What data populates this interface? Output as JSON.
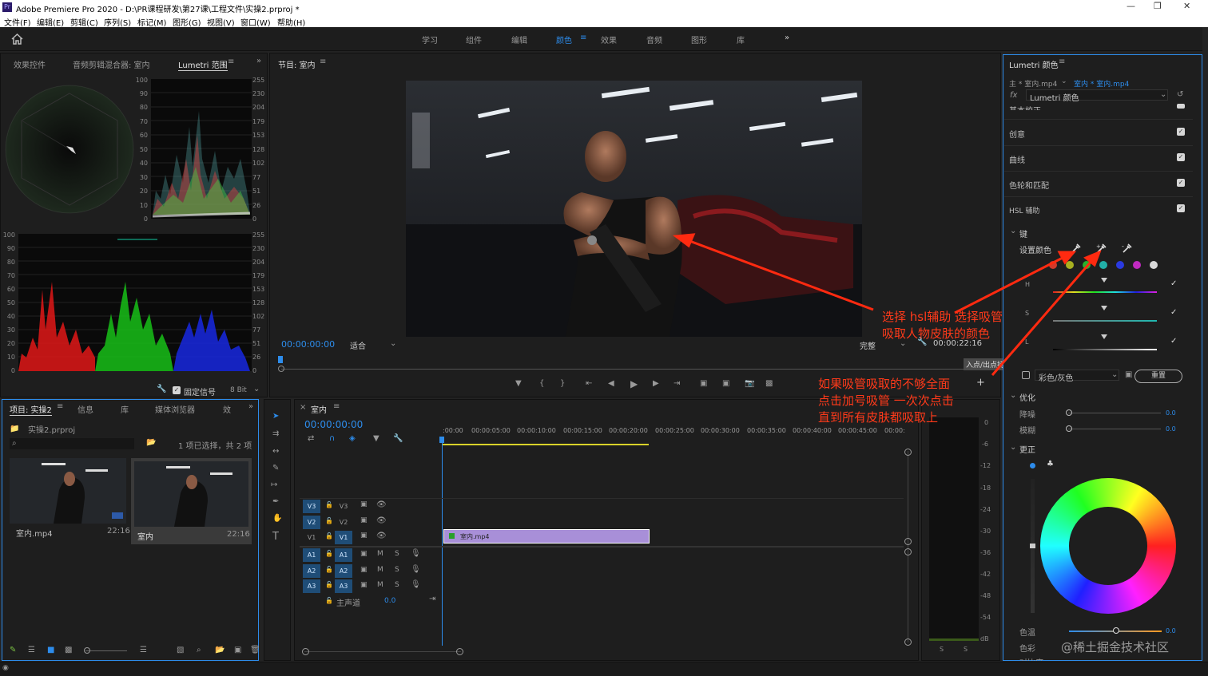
{
  "app": {
    "title": "Adobe Premiere Pro 2020 - D:\\PR课程研发\\第27课\\工程文件\\实操2.prproj *",
    "logo": "Pr"
  },
  "menu": [
    "文件(F)",
    "编辑(E)",
    "剪辑(C)",
    "序列(S)",
    "标记(M)",
    "图形(G)",
    "视图(V)",
    "窗口(W)",
    "帮助(H)"
  ],
  "workspaces": [
    "学习",
    "组件",
    "编辑",
    "颜色",
    "效果",
    "音频",
    "图形",
    "库"
  ],
  "active_workspace": "颜色",
  "left_tabs": {
    "effects": "效果控件",
    "mixer": "音频剪辑混合器: 室内",
    "scopes": "Lumetri 范围"
  },
  "scope_scale_left": [
    "100",
    "90",
    "80",
    "70",
    "60",
    "50",
    "40",
    "30",
    "20",
    "10",
    "0"
  ],
  "scope_scale_right": [
    "255",
    "230",
    "204",
    "179",
    "153",
    "128",
    "102",
    "77",
    "51",
    "26",
    "0"
  ],
  "scope_footer": {
    "clamp": "固定信号",
    "bit": "8 Bit"
  },
  "program": {
    "title": "节目: 室内",
    "timecode": "00:00:00:00",
    "fit": "适合",
    "quality": "完整",
    "duration": "00:00:22:16",
    "tooltip": "入点/出点持续时间"
  },
  "project": {
    "tabs": [
      "项目: 实操2",
      "信息",
      "库",
      "媒体浏览器",
      "效"
    ],
    "file": "实操2.prproj",
    "status": "1 项已选择，共 2 项",
    "items": [
      {
        "name": "室内.mp4",
        "dur": "22:16"
      },
      {
        "name": "室内",
        "dur": "22:16"
      }
    ]
  },
  "sequence": {
    "title": "室内",
    "timecode": "00:00:00:00",
    "ruler": [
      ":00:00",
      "00:00:05:00",
      "00:00:10:00",
      "00:00:15:00",
      "00:00:20:00",
      "00:00:25:00",
      "00:00:30:00",
      "00:00:35:00",
      "00:00:40:00",
      "00:00:45:00",
      "00:00:"
    ],
    "video_tracks": [
      "V3",
      "V2",
      "V1"
    ],
    "audio_tracks": [
      "A1",
      "A2",
      "A3"
    ],
    "master": "主声道",
    "master_val": "0.0",
    "clip": "室内.mp4"
  },
  "meter_scale": [
    "0",
    "-6",
    "-12",
    "-18",
    "-24",
    "-30",
    "-36",
    "-42",
    "-48",
    "-54",
    "dB"
  ],
  "meter_bottom": [
    "S",
    "S"
  ],
  "lumetri": {
    "title": "Lumetri 颜色",
    "source": "主 * 室内.mp4",
    "seq": "室内 * 室内.mp4",
    "fx": "Lumetri 颜色",
    "sections": [
      "基本校正",
      "创意",
      "曲线",
      "色轮和匹配",
      "HSL 辅助"
    ],
    "key": "键",
    "set_color": "设置颜色",
    "hsl": [
      "H",
      "S",
      "L"
    ],
    "gray": "彩色/灰色",
    "reset": "重置",
    "refine": "优化",
    "denoise": "降噪",
    "blur": "模糊",
    "denoise_val": "0.0",
    "blur_val": "0.0",
    "correct": "更正",
    "temp": "色温",
    "tint": "色彩",
    "temp_val": "0.0",
    "more": "对比度",
    "swatches": [
      "#d23a2a",
      "#a8b020",
      "#2ab02a",
      "#22b0a8",
      "#2a3ae0",
      "#c02ac0",
      "#d8d8d8"
    ]
  },
  "annotations": {
    "a1": "选择 hsl辅助 选择吸管\n吸取人物皮肤的颜色",
    "a2": "如果吸管吸取的不够全面\n点击加号吸管 一次次点击\n直到所有皮肤都吸取上"
  },
  "watermark": "@稀土掘金技术社区",
  "colors": {
    "accent": "#2d8ceb",
    "annotation": "#ff3a1a",
    "clip": "#a88fd8"
  }
}
